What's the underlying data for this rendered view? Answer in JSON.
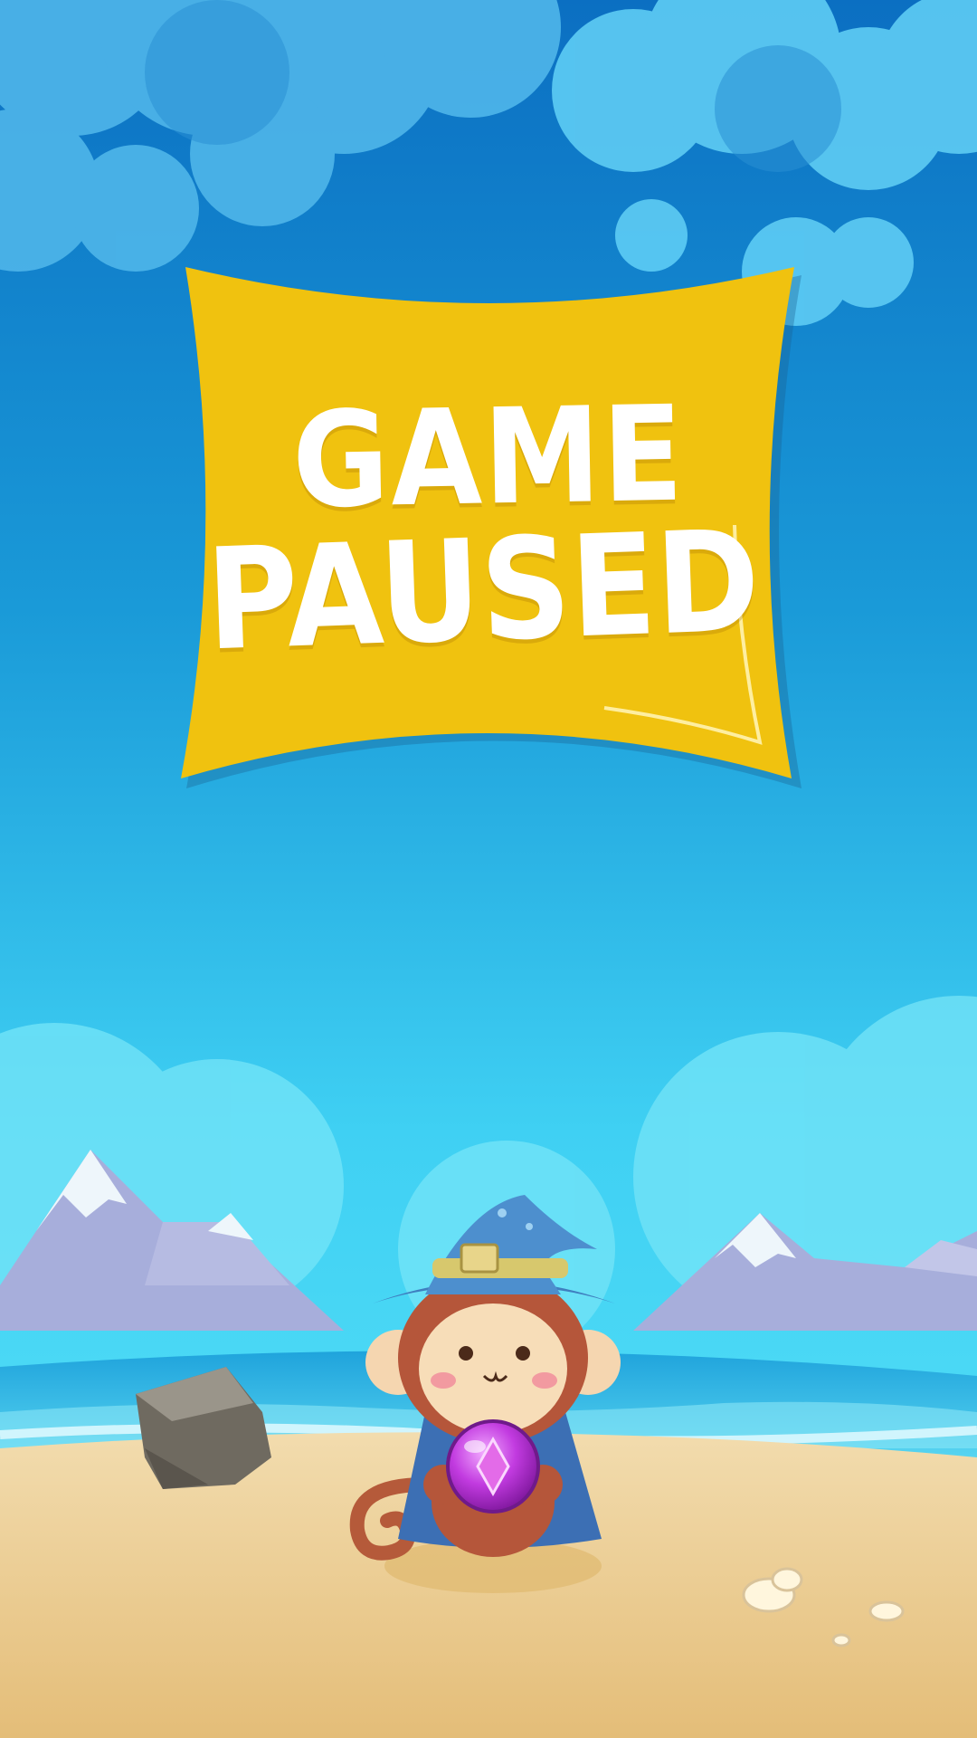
{
  "screen": {
    "title_line1": "GAME",
    "title_line2": "PAUSED"
  },
  "colors": {
    "sky_top": "#0e78c8",
    "sky_bottom": "#4fdcf7",
    "banner": "#f0c20f",
    "sand": "#eed39b",
    "sea": "#3fc6ee"
  },
  "icons": {
    "character": "wizard-monkey-icon",
    "orb": "magic-orb-icon",
    "rock": "rock-icon",
    "shells": "seashell-icon"
  }
}
